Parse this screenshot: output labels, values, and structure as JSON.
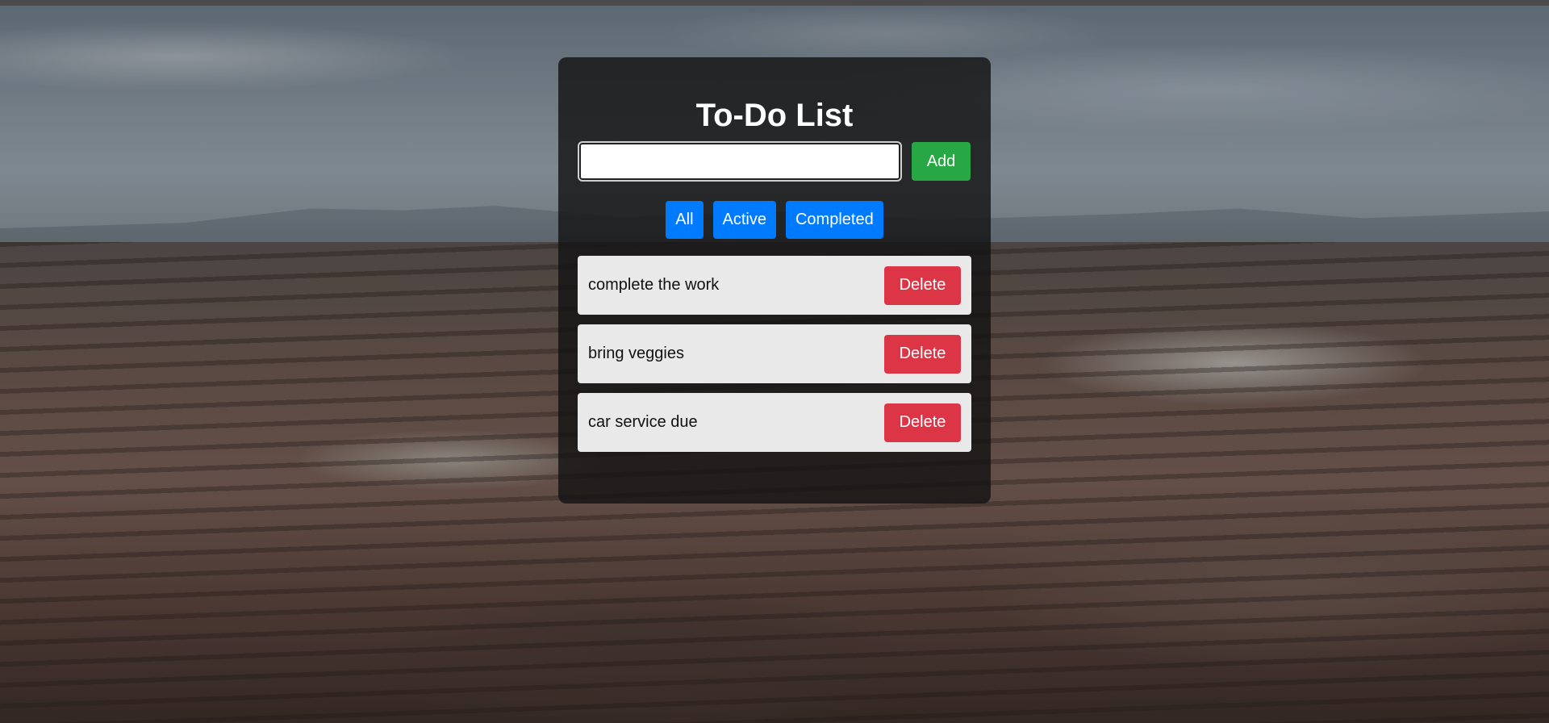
{
  "app": {
    "title": "To-Do List"
  },
  "input": {
    "value": "",
    "placeholder": ""
  },
  "add_button": {
    "label": "Add"
  },
  "filters": [
    {
      "label": "All"
    },
    {
      "label": "Active"
    },
    {
      "label": "Completed"
    }
  ],
  "tasks": [
    {
      "text": "complete the work",
      "action": "Delete"
    },
    {
      "text": "bring veggies",
      "action": "Delete"
    },
    {
      "text": "car service due",
      "action": "Delete"
    }
  ],
  "colors": {
    "add": "#28a745",
    "filter": "#007bff",
    "delete": "#dc3545",
    "card": "#141414",
    "task_bg": "#e9e9e9"
  }
}
